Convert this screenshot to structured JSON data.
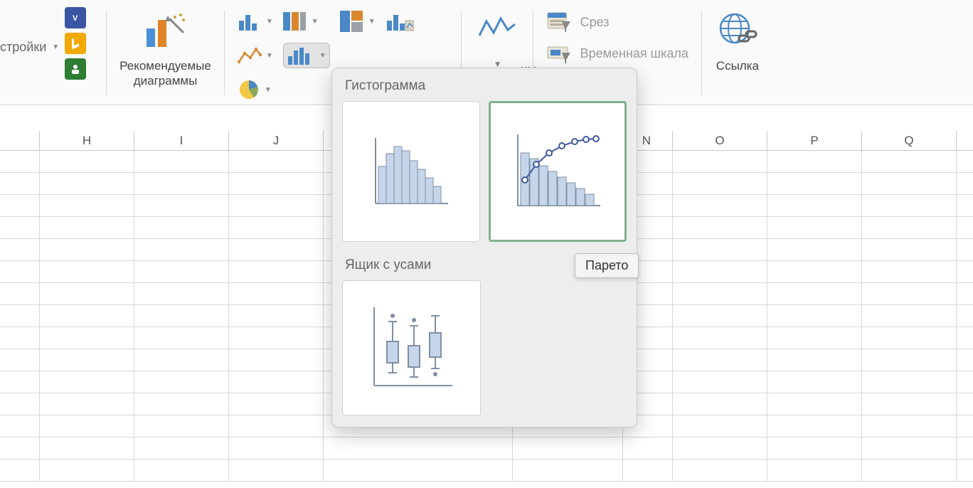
{
  "ribbon": {
    "addins_label": "стройки",
    "recommended_charts": "Рекомендуемые\nдиаграммы",
    "sparklines_fragment": "ны",
    "slicer": "Срез",
    "timeline": "Временная шкала",
    "link": "Ссылка"
  },
  "popup": {
    "section1": "Гистограмма",
    "section2": "Ящик с усами",
    "tooltip": "Парето"
  },
  "columns": [
    "",
    "H",
    "I",
    "J",
    "",
    "",
    "N",
    "O",
    "P",
    "Q"
  ],
  "icons": {
    "visio": "visio-icon",
    "bing": "bing-icon",
    "people": "people-icon"
  }
}
